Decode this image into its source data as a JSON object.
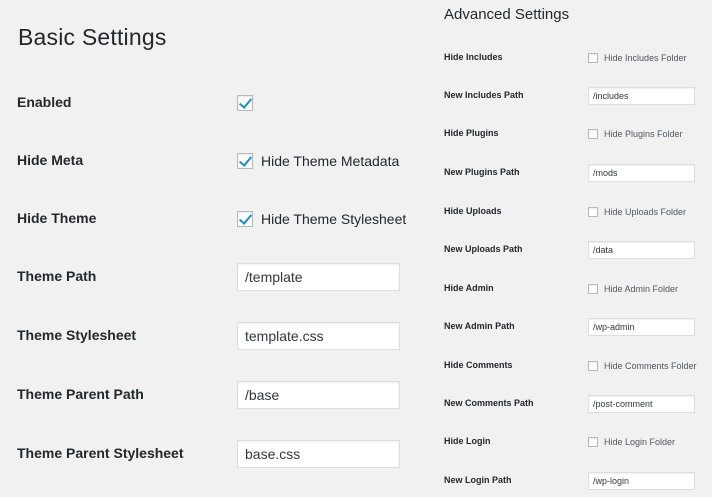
{
  "basic": {
    "title": "Basic Settings",
    "enabled": {
      "label": "Enabled",
      "checked": true
    },
    "hide_meta": {
      "label": "Hide Meta",
      "checked": true,
      "option_text": "Hide Theme Metadata"
    },
    "hide_theme": {
      "label": "Hide Theme",
      "checked": true,
      "option_text": "Hide Theme Stylesheet"
    },
    "theme_path": {
      "label": "Theme Path",
      "value": "/template"
    },
    "theme_stylesheet": {
      "label": "Theme Stylesheet",
      "value": "template.css"
    },
    "theme_parent_path": {
      "label": "Theme Parent Path",
      "value": "/base"
    },
    "theme_parent_stylesheet": {
      "label": "Theme Parent Stylesheet",
      "value": "base.css"
    }
  },
  "advanced": {
    "title": "Advanced Settings",
    "hide_includes": {
      "label": "Hide Includes",
      "checked": false,
      "option_text": "Hide Includes Folder"
    },
    "new_includes_path": {
      "label": "New Includes Path",
      "value": "/includes"
    },
    "hide_plugins": {
      "label": "Hide Plugins",
      "checked": false,
      "option_text": "Hide Plugins Folder"
    },
    "new_plugins_path": {
      "label": "New Plugins Path",
      "value": "/mods"
    },
    "hide_uploads": {
      "label": "Hide Uploads",
      "checked": false,
      "option_text": "Hide Uploads Folder"
    },
    "new_uploads_path": {
      "label": "New Uploads Path",
      "value": "/data"
    },
    "hide_admin": {
      "label": "Hide Admin",
      "checked": false,
      "option_text": "Hide Admin Folder"
    },
    "new_admin_path": {
      "label": "New Admin Path",
      "value": "/wp-admin"
    },
    "hide_comments": {
      "label": "Hide Comments",
      "checked": false,
      "option_text": "Hide Comments Folder"
    },
    "new_comments_path": {
      "label": "New Comments Path",
      "value": "/post-comment"
    },
    "hide_login": {
      "label": "Hide Login",
      "checked": false,
      "option_text": "Hide Login Folder"
    },
    "new_login_path": {
      "label": "New Login Path",
      "value": "/wp-login"
    }
  },
  "colors": {
    "background": "#f1f1f1",
    "text": "#23282d",
    "checkmark": "#1e8cbe",
    "input_border": "#dddddd"
  }
}
